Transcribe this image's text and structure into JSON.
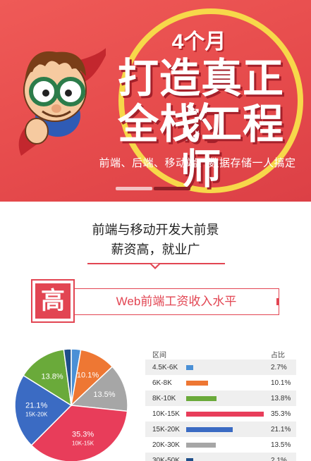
{
  "banner": {
    "months": "4个月",
    "headline_line1": "打造真正的",
    "headline_line2": "全栈工程师",
    "subline": "前端、后端、移动端、数据存储一人搞定"
  },
  "intro": {
    "line1": "前端与移动开发大前景",
    "line2": "薪资高，就业广"
  },
  "section": {
    "badge": "高",
    "title": "Web前端工资收入水平"
  },
  "table": {
    "col_range": "区间",
    "col_share": "占比",
    "rows": [
      {
        "range": "4.5K-6K",
        "share": "2.7%",
        "value": 2.7,
        "color": "#4a90d6"
      },
      {
        "range": "6K-8K",
        "share": "10.1%",
        "value": 10.1,
        "color": "#ee7733"
      },
      {
        "range": "8K-10K",
        "share": "13.8%",
        "value": 13.8,
        "color": "#6aaa3a"
      },
      {
        "range": "10K-15K",
        "share": "35.3%",
        "value": 35.3,
        "color": "#e83d5a"
      },
      {
        "range": "15K-20K",
        "share": "21.1%",
        "value": 21.1,
        "color": "#3b6bc3"
      },
      {
        "range": "20K-30K",
        "share": "13.5%",
        "value": 13.5,
        "color": "#a6a6a6"
      },
      {
        "range": "30K-50K",
        "share": "2.1%",
        "value": 2.1,
        "color": "#1f4f8a"
      }
    ]
  },
  "chart_data": {
    "type": "pie",
    "slices": [
      {
        "label": "4.5K-6K",
        "value": 2.7,
        "color": "#4a90d6",
        "text": ""
      },
      {
        "label": "6K-8K",
        "value": 10.1,
        "color": "#ee7733",
        "text": "10.1%"
      },
      {
        "label": "8K-10K",
        "value": 13.5,
        "color": "#a6a6a6",
        "text": "13.5%"
      },
      {
        "label": "10K-15K",
        "value": 35.3,
        "color": "#e83d5a",
        "text": "35.3%",
        "sub": "10K-15K"
      },
      {
        "label": "15K-20K",
        "value": 21.1,
        "color": "#3b6bc3",
        "text": "21.1%",
        "sub": "15K-20K"
      },
      {
        "label": "20K-30K",
        "value": 13.8,
        "color": "#6aaa3a",
        "text": "13.8%"
      },
      {
        "label": "30K-50K",
        "value": 2.1,
        "color": "#1f4f8a",
        "text": ""
      }
    ]
  }
}
